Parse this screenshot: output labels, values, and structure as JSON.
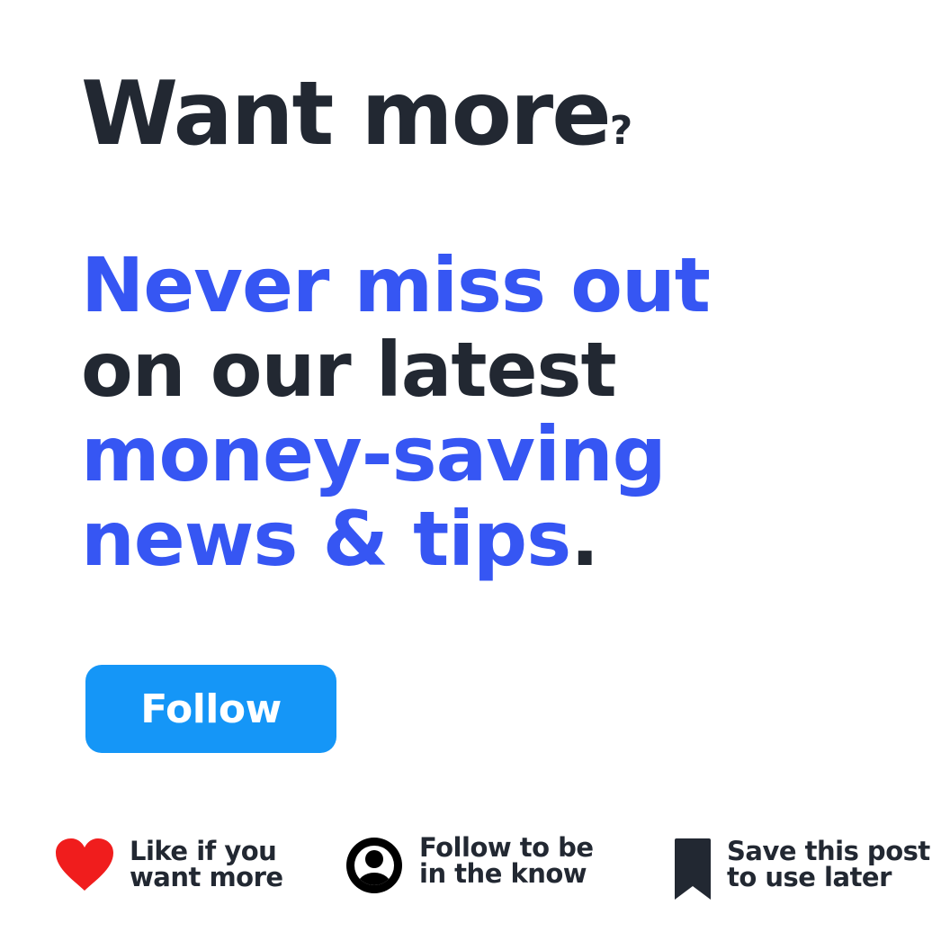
{
  "title": {
    "main": "Want more",
    "mark": "?"
  },
  "headline": {
    "line1": "Never miss out",
    "line2": "on our latest",
    "line3": "money-saving",
    "line4_blue": "news & tips",
    "line4_period": "."
  },
  "follow_button": {
    "label": "Follow"
  },
  "actions": {
    "like": {
      "icon": "heart-icon",
      "line1": "Like if you",
      "line2": "want more"
    },
    "follow": {
      "icon": "user-icon",
      "line1": "Follow to be",
      "line2": "in the know"
    },
    "save": {
      "icon": "bookmark-icon",
      "line1": "Save this post",
      "line2": "to use later"
    }
  },
  "colors": {
    "dark_text": "#222832",
    "accent_blue": "#3656f3",
    "button_blue": "#1596f7",
    "heart_red": "#f01d1d",
    "background": "#ffffff"
  }
}
